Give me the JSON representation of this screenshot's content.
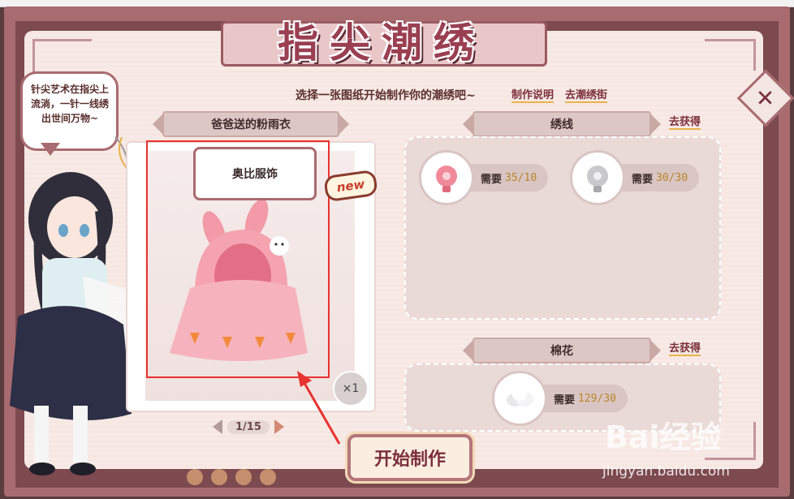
{
  "title": "指尖潮绣",
  "subtitle": "选择一张图纸开始制作你的潮绣吧~",
  "header_links": {
    "instructions": "制作说明",
    "go_street": "去潮绣街"
  },
  "speech_bubble": "针尖艺术在指尖上流淌，一针一线绣出世间万物~",
  "pattern": {
    "name": "爸爸送的粉雨衣",
    "brand": "奥比服饰",
    "new_badge": "new",
    "quantity": "×1",
    "page": "1/15"
  },
  "thread_section": {
    "label": "绣线",
    "get_link": "去获得",
    "items": [
      {
        "icon": "pink-thread-icon",
        "need_label": "需要",
        "count": "35/10"
      },
      {
        "icon": "silver-thread-icon",
        "need_label": "需要",
        "count": "30/30"
      }
    ]
  },
  "cotton_section": {
    "label": "棉花",
    "get_link": "去获得",
    "items": [
      {
        "icon": "cotton-icon",
        "need_label": "需要",
        "count": "129/30"
      }
    ]
  },
  "start_button": "开始制作",
  "watermark": {
    "logo": "Bai经验",
    "url": "jingyan.baidu.com"
  },
  "colors": {
    "accent": "#7b2f3c",
    "frame": "#a86b70",
    "highlight_box": "#e8322f",
    "count_text": "#b8862a"
  }
}
